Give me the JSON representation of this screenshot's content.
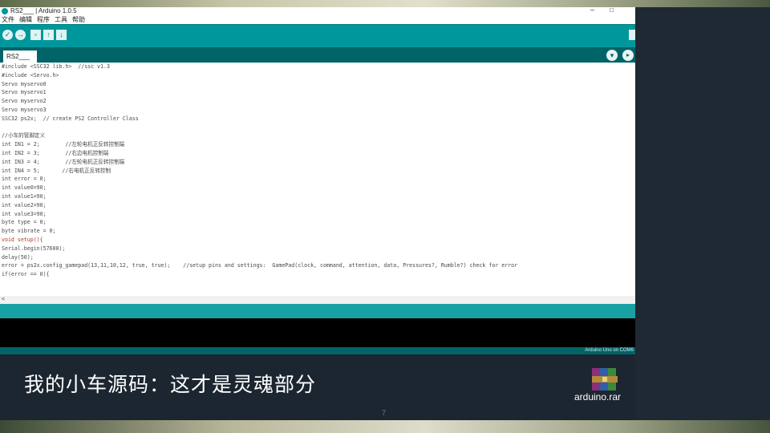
{
  "window": {
    "title": "RS2___ | Arduino 1.0.5",
    "minimize_glyph": "–",
    "maximize_glyph": "□"
  },
  "menu": [
    "文件",
    "编辑",
    "程序",
    "工具",
    "帮助"
  ],
  "toolbar": {
    "verify_icon": "check-icon",
    "upload_icon": "arrow-right-icon",
    "new_icon": "new-file-icon",
    "open_icon": "arrow-up-icon",
    "save_icon": "arrow-down-icon"
  },
  "tab": {
    "label": "RS2___"
  },
  "code_lines": [
    "#include <SSC32 lib.h>  //ssc v1.3",
    "#include <Servo.h>",
    "Servo myservo0",
    "Servo myservo1",
    "Servo myservo2",
    "Servo myservo3",
    "SSC32 ps2x;  // create PS2 Controller Class",
    "",
    "//小车的管脚定义",
    "int IN1 = 2;        //左轮电机正反转控制端",
    "int IN2 = 3;        //右边电机控制端",
    "int IN3 = 4;        //左轮电机正反转控制端",
    "int IN4 = 5;       //右电机正反转控制",
    "int error = 0;",
    "int value0=90;",
    "int value1=90;",
    "int value2=90;",
    "int value3=90;",
    "byte type = 0;",
    "byte vibrate = 0;",
    "void setup(){",
    "Serial.begin(57600);",
    "delay(50);",
    "error = ps2x.config_gamepad(13,11,10,12, true, true);    //setup pins and settings:  GamePad(clock, command, attention, data, Pressures?, Rumble?) check for error",
    "if(error == 0){"
  ],
  "hscroll_text": "<",
  "footer_text": "Arduino Uno on COM6",
  "caption": "我的小车源码：这才是灵魂部分",
  "attachment": {
    "label": "arduino.rar",
    "icon": "winrar-archive-icon"
  },
  "page_number": "7",
  "colors": {
    "teal": "#00979c",
    "dark_teal": "#006468",
    "slide_bg": "#1c2630"
  }
}
